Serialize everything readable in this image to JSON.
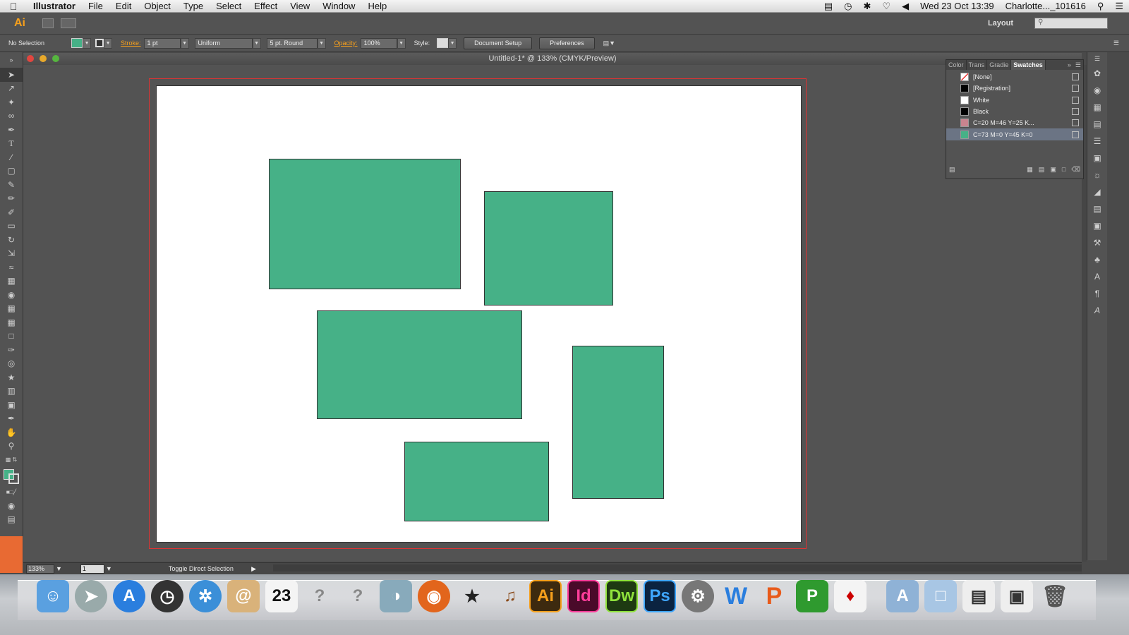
{
  "menubar": {
    "app": "Illustrator",
    "items": [
      "File",
      "Edit",
      "Object",
      "Type",
      "Select",
      "Effect",
      "View",
      "Window",
      "Help"
    ],
    "clock": "Wed 23 Oct  13:39",
    "user": "Charlotte..._101616"
  },
  "appbar": {
    "logo": "Ai",
    "workspace": "Layout"
  },
  "control": {
    "selection": "No Selection",
    "stroke_label": "Stroke:",
    "stroke_value": "1 pt",
    "profile": "Uniform",
    "brush": "5 pt. Round",
    "opacity_label": "Opacity:",
    "opacity_value": "100%",
    "style_label": "Style:",
    "doc_setup": "Document Setup",
    "preferences": "Preferences"
  },
  "document": {
    "title": "Untitled-1* @ 133% (CMYK/Preview)",
    "fill_color": "#46b187"
  },
  "swatches": {
    "tabs": [
      "Color",
      "Trans",
      "Gradie",
      "Swatches"
    ],
    "items": [
      {
        "label": "[None]",
        "color": "#ffffff"
      },
      {
        "label": "[Registration]",
        "color": "#000000"
      },
      {
        "label": "White",
        "color": "#ffffff"
      },
      {
        "label": "Black",
        "color": "#000000"
      },
      {
        "label": "C=20 M=46 Y=25 K...",
        "color": "#c9848f"
      },
      {
        "label": "C=73 M=0 Y=45 K=0",
        "color": "#46b187"
      }
    ]
  },
  "status": {
    "zoom": "133%",
    "page": "1",
    "tool_hint": "Toggle Direct Selection"
  },
  "dock": [
    "Ai",
    "Id",
    "Dw",
    "Ps"
  ]
}
